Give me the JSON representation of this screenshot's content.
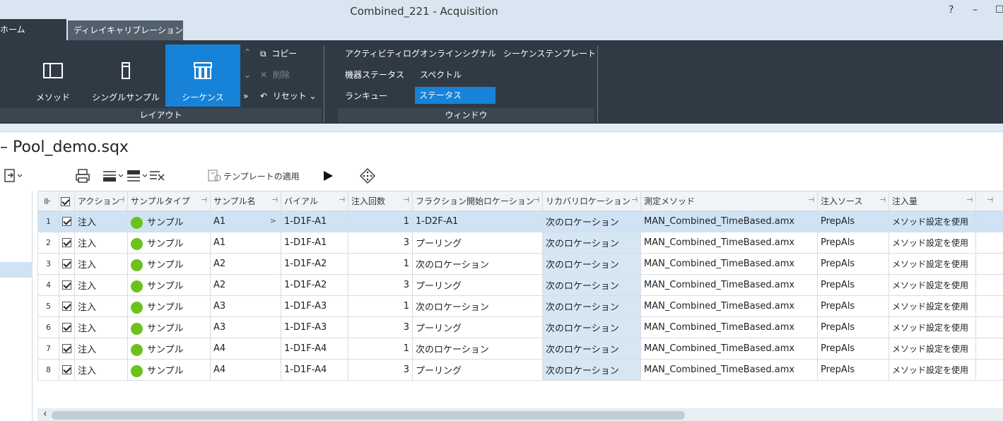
{
  "window": {
    "title": "Combined_221 - Acquisition",
    "help": "?",
    "minimize": "–",
    "maximize": "☐"
  },
  "tabs": [
    {
      "label": "ホーム"
    },
    {
      "label": "ディレイキャリブレーション"
    }
  ],
  "ribbon": {
    "layout": {
      "method": "メソッド",
      "single_sample": "シングルサンプル",
      "sequence": "シーケンス",
      "copy": "コピー",
      "delete": "削除",
      "reset": "リセット",
      "group_label": "レイアウト"
    },
    "window": {
      "items": [
        "アクティビティログ",
        "オンラインシグナル",
        "シーケンステンプレート",
        "機器ステータス",
        "スペクトル",
        "ランキュー",
        "ステータス"
      ],
      "group_label": "ウィンドウ"
    }
  },
  "document": {
    "title": "– Pool_demo.sqx",
    "apply_template": "テンプレートの適用"
  },
  "grid": {
    "columns": [
      "アクション",
      "サンプルタイプ",
      "サンプル名",
      "バイアル",
      "注入回数",
      "フラクション開始ロケーション",
      "リカバリロケーション",
      "測定メソッド",
      "注入ソース",
      "注入量"
    ],
    "rows": [
      {
        "n": "1",
        "action": "注入",
        "type": "サンプル",
        "name": "A1",
        "vial": "1-D1F-A1",
        "count": "1",
        "frac": "1-D2F-A1",
        "recovery": "次のロケーション",
        "method": "MAN_Combined_TimeBased.amx",
        "source": "PrepAls",
        "volume": "メソッド設定を使用"
      },
      {
        "n": "2",
        "action": "注入",
        "type": "サンプル",
        "name": "A1",
        "vial": "1-D1F-A1",
        "count": "3",
        "frac": "プーリング",
        "recovery": "次のロケーション",
        "method": "MAN_Combined_TimeBased.amx",
        "source": "PrepAls",
        "volume": "メソッド設定を使用"
      },
      {
        "n": "3",
        "action": "注入",
        "type": "サンプル",
        "name": "A2",
        "vial": "1-D1F-A2",
        "count": "1",
        "frac": "次のロケーション",
        "recovery": "次のロケーション",
        "method": "MAN_Combined_TimeBased.amx",
        "source": "PrepAls",
        "volume": "メソッド設定を使用"
      },
      {
        "n": "4",
        "action": "注入",
        "type": "サンプル",
        "name": "A2",
        "vial": "1-D1F-A2",
        "count": "3",
        "frac": "プーリング",
        "recovery": "次のロケーション",
        "method": "MAN_Combined_TimeBased.amx",
        "source": "PrepAls",
        "volume": "メソッド設定を使用"
      },
      {
        "n": "5",
        "action": "注入",
        "type": "サンプル",
        "name": "A3",
        "vial": "1-D1F-A3",
        "count": "1",
        "frac": "次のロケーション",
        "recovery": "次のロケーション",
        "method": "MAN_Combined_TimeBased.amx",
        "source": "PrepAls",
        "volume": "メソッド設定を使用"
      },
      {
        "n": "6",
        "action": "注入",
        "type": "サンプル",
        "name": "A3",
        "vial": "1-D1F-A3",
        "count": "3",
        "frac": "プーリング",
        "recovery": "次のロケーション",
        "method": "MAN_Combined_TimeBased.amx",
        "source": "PrepAls",
        "volume": "メソッド設定を使用"
      },
      {
        "n": "7",
        "action": "注入",
        "type": "サンプル",
        "name": "A4",
        "vial": "1-D1F-A4",
        "count": "1",
        "frac": "次のロケーション",
        "recovery": "次のロケーション",
        "method": "MAN_Combined_TimeBased.amx",
        "source": "PrepAls",
        "volume": "メソッド設定を使用"
      },
      {
        "n": "8",
        "action": "注入",
        "type": "サンプル",
        "name": "A4",
        "vial": "1-D1F-A4",
        "count": "3",
        "frac": "プーリング",
        "recovery": "次のロケーション",
        "method": "MAN_Combined_TimeBased.amx",
        "source": "PrepAls",
        "volume": "メソッド設定を使用"
      }
    ]
  },
  "colors": {
    "ribbon_bg": "#2f3a45",
    "selected_blue": "#1683d8",
    "status_green": "#6cc21b",
    "row_selected": "#cfe3f5"
  }
}
